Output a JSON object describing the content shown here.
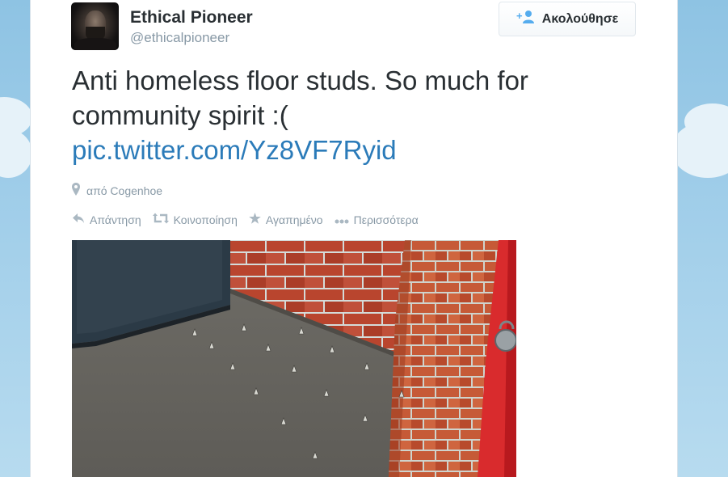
{
  "tweet": {
    "author": {
      "fullname": "Ethical Pioneer",
      "username": "@ethicalpioneer"
    },
    "follow_button": {
      "label": "Ακολούθησε",
      "icon": "follow-person-plus-icon",
      "accent": "#55acee"
    },
    "text": "Anti homeless floor studs. So much for community spirit :(",
    "link": "pic.twitter.com/Yz8VF7Ryid",
    "location": {
      "icon": "location-pin-icon",
      "label": "από Cogenhoe"
    },
    "actions": [
      {
        "icon": "reply-icon",
        "label": "Απάντηση"
      },
      {
        "icon": "retweet-icon",
        "label": "Κοινοποίηση"
      },
      {
        "icon": "star-icon",
        "label": "Αγαπημένο"
      },
      {
        "icon": "more-dots-icon",
        "label": "Περισσότερα"
      }
    ],
    "photo": {
      "subject": "floor-studs-photo"
    }
  },
  "colors": {
    "link": "#2b7bb9",
    "muted": "#8899a6",
    "text": "#292f33",
    "background_sky": "#a9cfe8"
  }
}
